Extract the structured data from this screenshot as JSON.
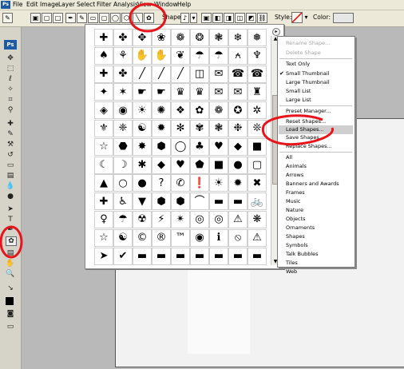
{
  "menubar": {
    "logo": "Ps",
    "items": [
      "File",
      "Edit",
      "Image",
      "Layer",
      "Select",
      "Filter",
      "Analysis",
      "View",
      "Window",
      "Help"
    ]
  },
  "options_bar": {
    "shape_label": "Shape:",
    "style_label": "Style:",
    "color_label": "Color:"
  },
  "toolbox": {
    "logo": "Ps"
  },
  "shape_picker": {
    "shapes": [
      "✚",
      "✤",
      "✥",
      "❀",
      "❁",
      "❂",
      "❃",
      "❄",
      "❅",
      "♠",
      "⚘",
      "✋",
      "✋",
      "❦",
      "☂",
      "☂",
      "⍲",
      "♆",
      "✚",
      "✤",
      "╱",
      "╱",
      "╱",
      "◫",
      "✉",
      "☎",
      "☎",
      "✦",
      "✶",
      "☛",
      "☛",
      "♛",
      "♛",
      "✉",
      "✉",
      "♜",
      "◈",
      "◉",
      "☀",
      "✺",
      "❖",
      "✿",
      "❁",
      "✪",
      "✲",
      "⚜",
      "❈",
      "☯",
      "✹",
      "✻",
      "✾",
      "❃",
      "❉",
      "❊",
      "☆",
      "⬣",
      "✸",
      "⬢",
      "◯",
      "♣",
      "♥",
      "◆",
      "■",
      "☾",
      "☽",
      "✱",
      "◆",
      "♥",
      "⬟",
      "■",
      "●",
      "▢",
      "▲",
      "○",
      "●",
      "?",
      "✆",
      "❗",
      "☀",
      "✹",
      "✖",
      "✚",
      "♿",
      "▼",
      "⬢",
      "⬢",
      "⌒",
      "▬",
      "▬",
      "🚲",
      "♀",
      "☂",
      "☢",
      "⚡",
      "✴",
      "◎",
      "◎",
      "⚠",
      "❋",
      "☆",
      "☯",
      "©",
      "®",
      "™",
      "◉",
      "ℹ",
      "⦸",
      "⚠",
      "➤",
      "✔",
      "▬",
      "▬",
      "▬",
      "▬",
      "▬",
      "▬",
      "▬"
    ]
  },
  "flyout_menu": {
    "items": [
      {
        "label": "Rename Shape...",
        "enabled": false,
        "checked": false
      },
      {
        "label": "Delete Shape",
        "enabled": false,
        "checked": false
      },
      {
        "label": "Text Only",
        "enabled": true,
        "checked": false
      },
      {
        "label": "Small Thumbnail",
        "enabled": true,
        "checked": true
      },
      {
        "label": "Large Thumbnail",
        "enabled": true,
        "checked": false
      },
      {
        "label": "Small List",
        "enabled": true,
        "checked": false
      },
      {
        "label": "Large List",
        "enabled": true,
        "checked": false
      },
      {
        "label": "Preset Manager...",
        "enabled": true,
        "checked": false
      },
      {
        "label": "Reset Shapes...",
        "enabled": true,
        "checked": false
      },
      {
        "label": "Load Shapes...",
        "enabled": true,
        "checked": false,
        "highlighted": true
      },
      {
        "label": "Save Shapes...",
        "enabled": true,
        "checked": false
      },
      {
        "label": "Replace Shapes...",
        "enabled": true,
        "checked": false
      },
      {
        "label": "All",
        "enabled": true,
        "checked": false
      },
      {
        "label": "Animals",
        "enabled": true,
        "checked": false
      },
      {
        "label": "Arrows",
        "enabled": true,
        "checked": false
      },
      {
        "label": "Banners and Awards",
        "enabled": true,
        "checked": false
      },
      {
        "label": "Frames",
        "enabled": true,
        "checked": false
      },
      {
        "label": "Music",
        "enabled": true,
        "checked": false
      },
      {
        "label": "Nature",
        "enabled": true,
        "checked": false
      },
      {
        "label": "Objects",
        "enabled": true,
        "checked": false
      },
      {
        "label": "Ornaments",
        "enabled": true,
        "checked": false
      },
      {
        "label": "Shapes",
        "enabled": true,
        "checked": false
      },
      {
        "label": "Symbols",
        "enabled": true,
        "checked": false
      },
      {
        "label": "Talk Bubbles",
        "enabled": true,
        "checked": false
      },
      {
        "label": "Tiles",
        "enabled": true,
        "checked": false
      },
      {
        "label": "Web",
        "enabled": true,
        "checked": false
      }
    ]
  },
  "colors": {
    "annotation": "#e8141b",
    "highlight": "#cfcfcf",
    "ps_blue": "#1c5aa6"
  }
}
